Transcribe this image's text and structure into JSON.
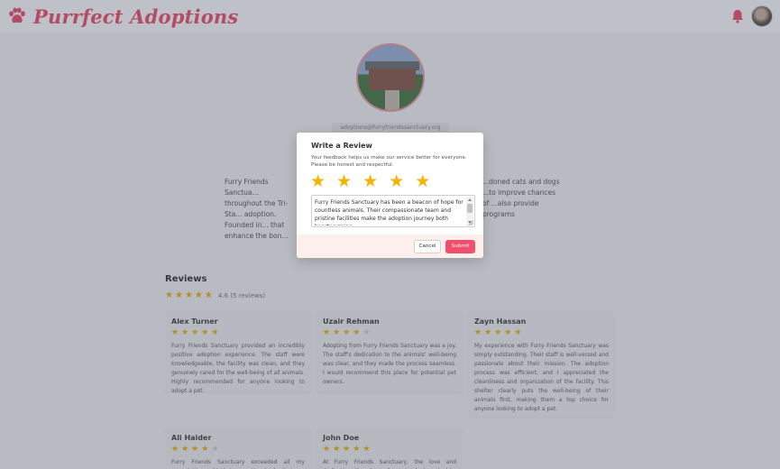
{
  "app": {
    "name": "Purrfect Adoptions",
    "accent_color": "#f0506e"
  },
  "header": {
    "logo_icon": "paw-icon",
    "notification_icon": "bell-icon",
    "avatar_label": "user-avatar"
  },
  "profile": {
    "email": "adoptions@furryfriendssanctuary.org",
    "about_left": "Furry Friends Sanctua... throughout the Tri-Sta... adoption. Founded in... that enhance the bon...",
    "about_right": "...doned cats and dogs ...to improve chances of ...also provide programs"
  },
  "reviews": {
    "title": "Reviews",
    "rating": 4.6,
    "summary": "4.6 (5 reviews)",
    "items": [
      {
        "name": "Alex Turner",
        "stars": 5,
        "text": "Furry Friends Sanctuary provided an incredibly positive adoption experience. The staff were knowledgeable, the facility was clean, and they genuinely cared for the well-being of all animals. Highly recommended for anyone looking to adopt a pet."
      },
      {
        "name": "Uzair Rehman",
        "stars": 4,
        "text": "Adopting from Furry Friends Sanctuary was a joy. The staff's dedication to the animals' well-being was clear, and they made the process seamless. I would recommend this place for potential pet owners."
      },
      {
        "name": "Zayn Hassan",
        "stars": 5,
        "text": "My experience with Furry Friends Sanctuary was simply outstanding. Their staff is well-versed and passionate about their mission. The adoption process was efficient, and I appreciated the cleanliness and organization of the facility. This shelter clearly puts the well-being of their animals first, making them a top choice for anyone looking to adopt a pet."
      },
      {
        "name": "Ali Haider",
        "stars": 4,
        "text": "Furry Friends Sanctuary exceeded all my expectations with their exceptional adoption"
      },
      {
        "name": "John Doe",
        "stars": 5,
        "text": "At Furry Friends Sanctuary, the love and dedication they have for animals is palpable. The entire"
      }
    ]
  },
  "modal": {
    "title": "Write a Review",
    "description": "Your feedback helps us make our service better for everyone. Please be honest and respectful.",
    "selected_stars": 5,
    "review_text": "Furry Friends Sanctuary has been a beacon of hope for countless animals. Their compassionate team and pristine facilities make the adoption journey both heartwarming",
    "cancel_label": "Cancel",
    "submit_label": "Submit"
  }
}
